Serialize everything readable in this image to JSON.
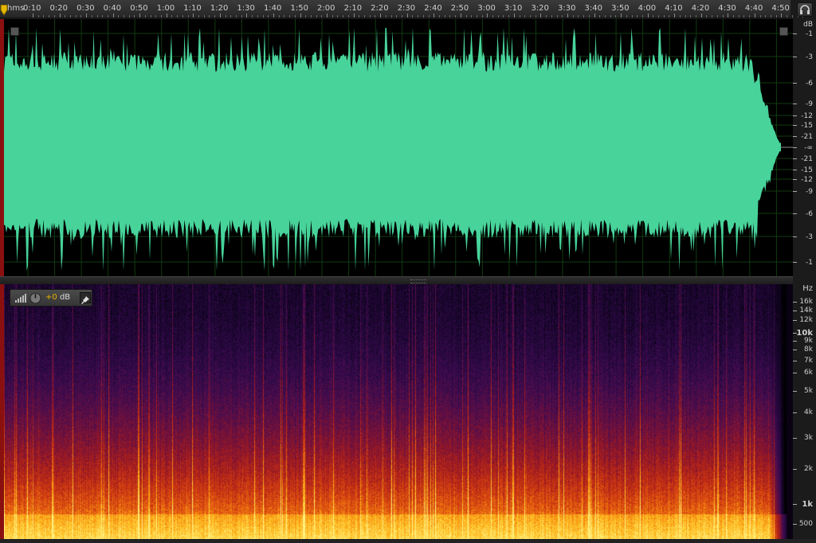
{
  "ruler": {
    "unit_label": "hms",
    "time_labels": [
      "0:10",
      "0:20",
      "0:30",
      "0:40",
      "0:50",
      "1:00",
      "1:10",
      "1:20",
      "1:30",
      "1:40",
      "1:50",
      "2:00",
      "2:10",
      "2:20",
      "2:30",
      "2:40",
      "2:50",
      "3:00",
      "3:10",
      "3:20",
      "3:30",
      "3:40",
      "3:50",
      "4:00",
      "4:10",
      "4:20",
      "4:30",
      "4:40",
      "4:50"
    ]
  },
  "headphones_icon": "headphones-icon",
  "waveform": {
    "color": "#47d39a",
    "db_unit": "dB",
    "db_labels": [
      "-1",
      "-3",
      "-6",
      "-9",
      "-12",
      "-15",
      "-21",
      "-∞",
      "-21",
      "-15",
      "-12",
      "-9",
      "-6",
      "-3",
      "-1"
    ]
  },
  "spectrogram": {
    "hz_unit": "Hz",
    "hz_labels": [
      "16k",
      "14k",
      "12k",
      "10k",
      "9k",
      "8k",
      "7k",
      "6k",
      "5k",
      "4k",
      "3k",
      "2k",
      "1k",
      "500"
    ],
    "toolbar": {
      "gain_value": "+0",
      "gain_unit": "dB",
      "icons": [
        "signal-bars-icon",
        "knob-icon",
        "pin-icon"
      ]
    },
    "palette": [
      "#000000",
      "#1a0630",
      "#3a0b50",
      "#6a1040",
      "#a01a20",
      "#d03a10",
      "#f07a10",
      "#ffc020",
      "#fff080"
    ]
  }
}
